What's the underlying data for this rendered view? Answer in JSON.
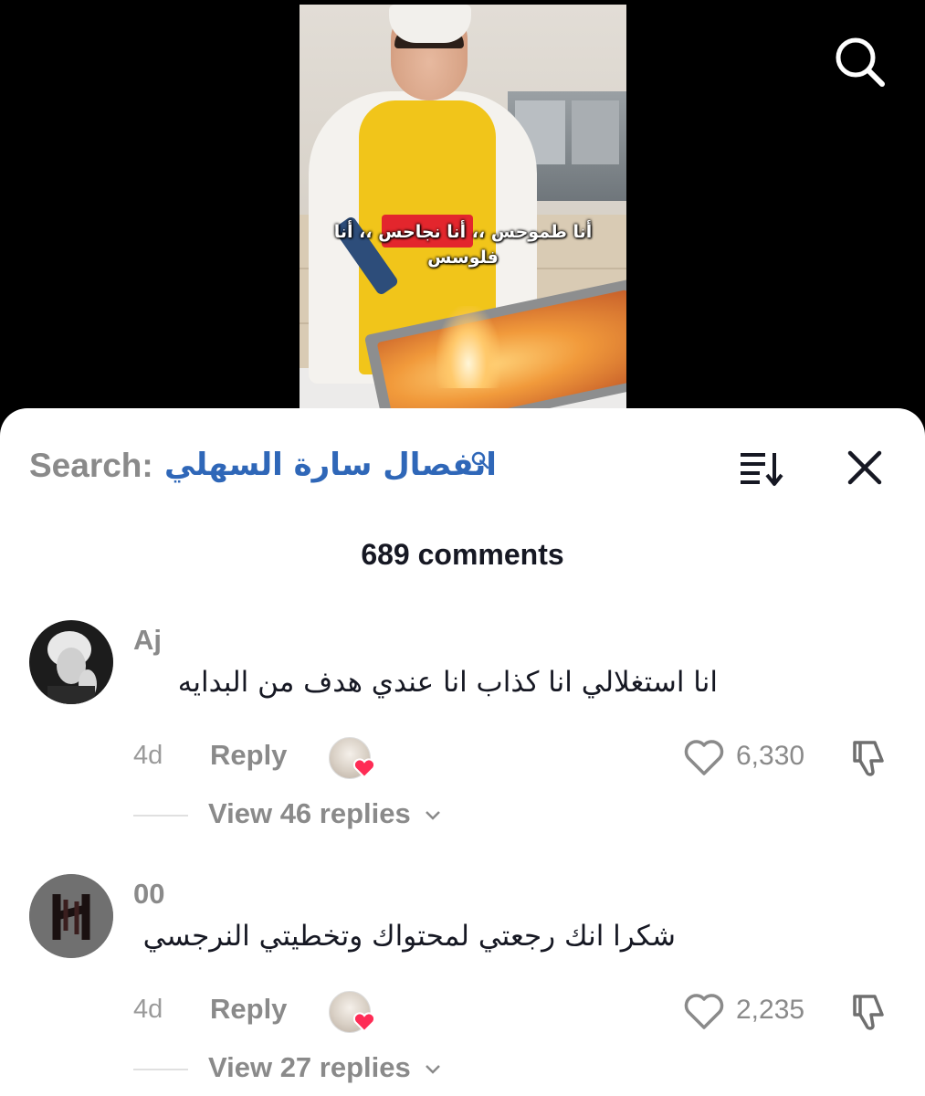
{
  "video": {
    "caption": "أنا طموحس ،، أنا نجاحس ،، أنا فلوسس"
  },
  "header": {
    "search_label": "Search:",
    "search_term": "انفصال سارة السهلي",
    "search_icon": "search-icon",
    "sort_icon": "sort-icon",
    "close_icon": "close-icon"
  },
  "comments_count": "689 comments",
  "comments": [
    {
      "username": "Aj",
      "text": "انا استغلالي انا كذاب انا عندي هدف من البدايه",
      "time": "4d",
      "reply_label": "Reply",
      "likes": "6,330",
      "view_replies": "View 46 replies",
      "creator_liked": true
    },
    {
      "username": "00",
      "text": "شكرا انك رجعتي لمحتواك وتخطيتي النرجسي",
      "time": "4d",
      "reply_label": "Reply",
      "likes": "2,235",
      "view_replies": "View 27 replies",
      "creator_liked": true
    }
  ],
  "colors": {
    "accent_link": "#2f67b8",
    "heart": "#fe2c55",
    "muted_text": "#8a8a8a",
    "primary_text": "#161823"
  }
}
